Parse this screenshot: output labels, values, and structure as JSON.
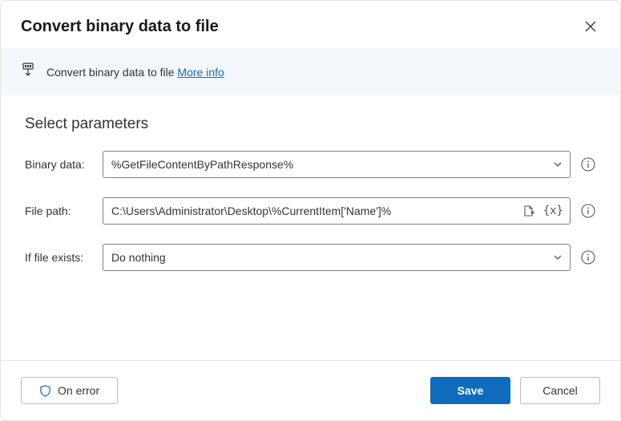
{
  "dialog": {
    "title": "Convert binary data to file"
  },
  "banner": {
    "text": "Convert binary data to file",
    "link": "More info"
  },
  "section": {
    "title": "Select parameters"
  },
  "fields": {
    "binary_data": {
      "label": "Binary data:",
      "value": "%GetFileContentByPathResponse%"
    },
    "file_path": {
      "label": "File path:",
      "value": "C:\\Users\\Administrator\\Desktop\\%CurrentItem['Name']%"
    },
    "if_exists": {
      "label": "If file exists:",
      "value": "Do nothing"
    }
  },
  "buttons": {
    "on_error": "On error",
    "save": "Save",
    "cancel": "Cancel"
  }
}
